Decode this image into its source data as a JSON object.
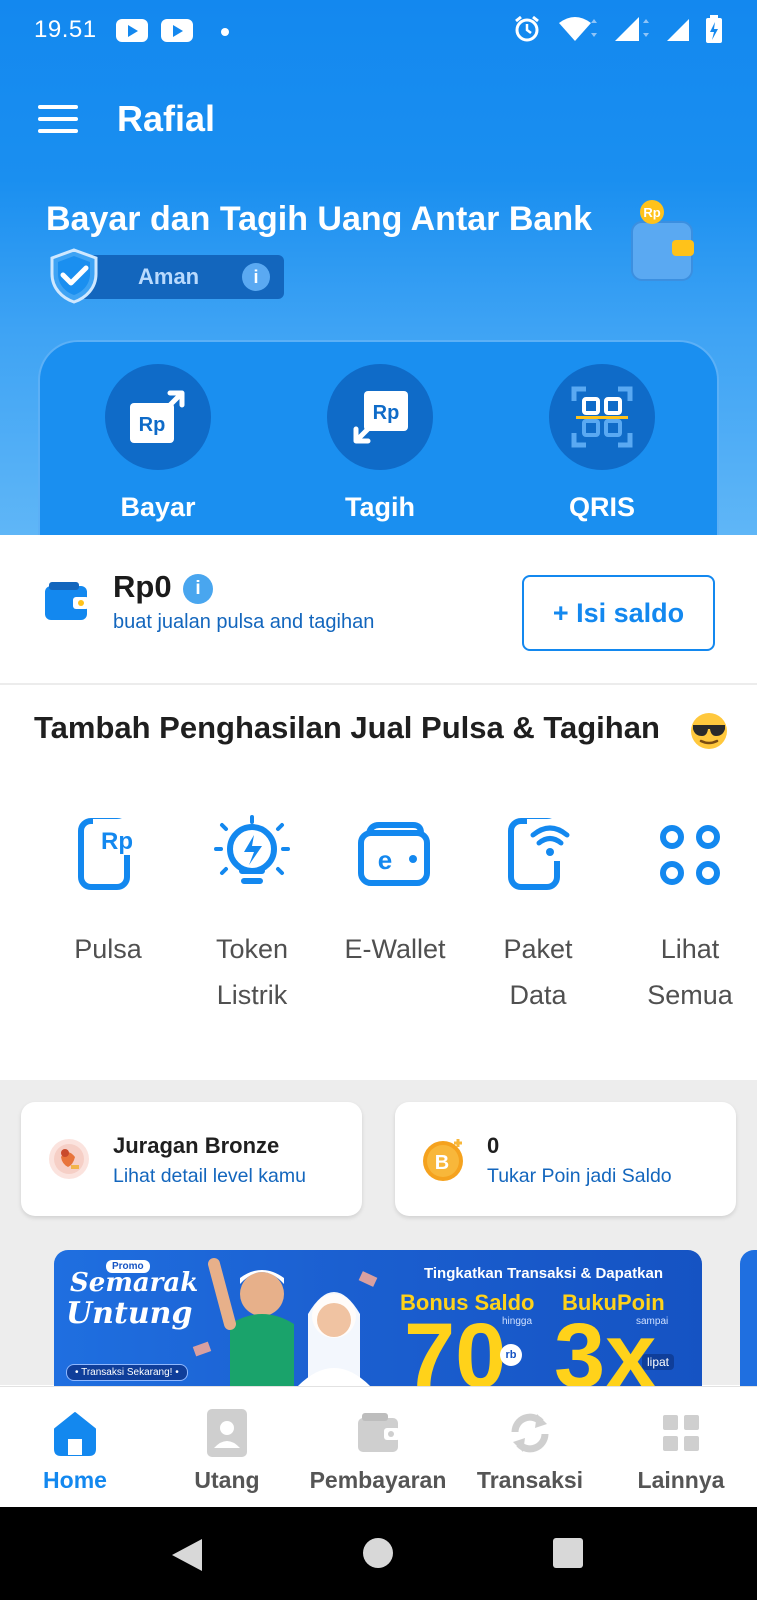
{
  "status_bar": {
    "time": "19.51"
  },
  "app_bar": {
    "title": "Rafial"
  },
  "hero": {
    "title": "Bayar dan Tagih Uang Antar Bank",
    "badge_label": "Aman",
    "info_glyph": "i",
    "wallet_coin_label": "Rp"
  },
  "quick_actions": [
    {
      "label": "Bayar",
      "icon": "rp-send-icon"
    },
    {
      "label": "Tagih",
      "icon": "rp-receive-icon"
    },
    {
      "label": "QRIS",
      "icon": "qris-icon"
    }
  ],
  "saldo": {
    "amount": "Rp0",
    "info_glyph": "i",
    "subtitle": "buat jualan pulsa and tagihan",
    "button_label": "+ Isi saldo"
  },
  "section": {
    "title": "Tambah Penghasilan Jual Pulsa & Tagihan"
  },
  "products": [
    {
      "line1": "Pulsa",
      "line2": "",
      "icon": "phone-rp-icon"
    },
    {
      "line1": "Token",
      "line2": "Listrik",
      "icon": "lightbulb-icon"
    },
    {
      "line1": "E-Wallet",
      "line2": "",
      "icon": "ewallet-icon"
    },
    {
      "line1": "Paket",
      "line2": "Data",
      "icon": "phone-wifi-icon"
    },
    {
      "line1": "Lihat",
      "line2": "Semua",
      "icon": "grid-icon"
    }
  ],
  "cards": [
    {
      "title": "Juragan Bronze",
      "subtitle": "Lihat detail level kamu",
      "icon": "bronze-badge-icon"
    },
    {
      "title": "0",
      "subtitle": "Tukar Poin jadi Saldo",
      "icon": "bukupoin-coin-icon",
      "icon_letter": "B"
    }
  ],
  "banner": {
    "promo_tag": "Promo",
    "brand_line1": "Semarak",
    "brand_line2": "Untung",
    "cta": "• Transaksi Sekarang! •",
    "headline": "Tingkatkan Transaksi & Dapatkan",
    "bonus_label": "Bonus Saldo",
    "bonus_prefix": "hingga",
    "bonus_value": "70",
    "bonus_unit": "rb",
    "poin_label": "BukuPoin",
    "poin_prefix": "sampai",
    "poin_value": "3x",
    "poin_unit": "lipat"
  },
  "bottom_nav": [
    {
      "label": "Home",
      "icon": "home-icon",
      "active": true
    },
    {
      "label": "Utang",
      "icon": "contact-book-icon",
      "active": false
    },
    {
      "label": "Pembayaran",
      "icon": "wallet-icon",
      "active": false
    },
    {
      "label": "Transaksi",
      "icon": "sync-icon",
      "active": false
    },
    {
      "label": "Lainnya",
      "icon": "more-grid-icon",
      "active": false
    }
  ],
  "colors": {
    "primary": "#1388ef",
    "dark_blue": "#1366bd",
    "accent_yellow": "#ffd21a",
    "text_dark": "#1f1f1f"
  }
}
